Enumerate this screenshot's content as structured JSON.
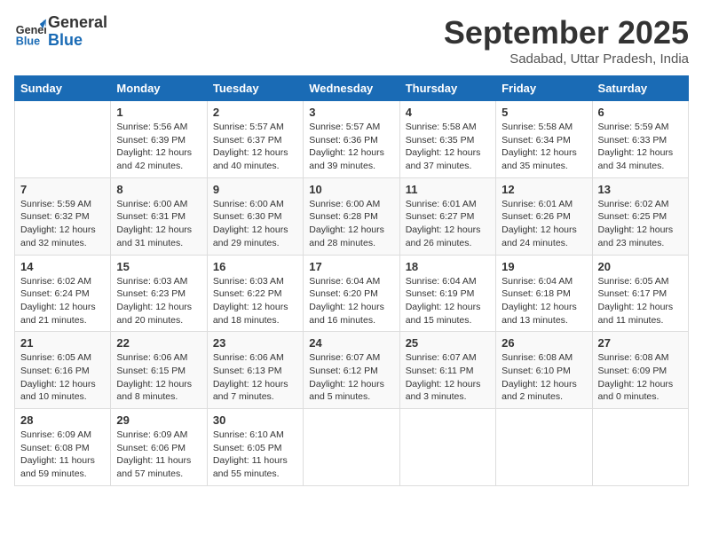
{
  "logo": {
    "line1": "General",
    "line2": "Blue"
  },
  "title": "September 2025",
  "subtitle": "Sadabad, Uttar Pradesh, India",
  "days_of_week": [
    "Sunday",
    "Monday",
    "Tuesday",
    "Wednesday",
    "Thursday",
    "Friday",
    "Saturday"
  ],
  "weeks": [
    [
      {
        "day": "",
        "info": ""
      },
      {
        "day": "1",
        "info": "Sunrise: 5:56 AM\nSunset: 6:39 PM\nDaylight: 12 hours\nand 42 minutes."
      },
      {
        "day": "2",
        "info": "Sunrise: 5:57 AM\nSunset: 6:37 PM\nDaylight: 12 hours\nand 40 minutes."
      },
      {
        "day": "3",
        "info": "Sunrise: 5:57 AM\nSunset: 6:36 PM\nDaylight: 12 hours\nand 39 minutes."
      },
      {
        "day": "4",
        "info": "Sunrise: 5:58 AM\nSunset: 6:35 PM\nDaylight: 12 hours\nand 37 minutes."
      },
      {
        "day": "5",
        "info": "Sunrise: 5:58 AM\nSunset: 6:34 PM\nDaylight: 12 hours\nand 35 minutes."
      },
      {
        "day": "6",
        "info": "Sunrise: 5:59 AM\nSunset: 6:33 PM\nDaylight: 12 hours\nand 34 minutes."
      }
    ],
    [
      {
        "day": "7",
        "info": "Sunrise: 5:59 AM\nSunset: 6:32 PM\nDaylight: 12 hours\nand 32 minutes."
      },
      {
        "day": "8",
        "info": "Sunrise: 6:00 AM\nSunset: 6:31 PM\nDaylight: 12 hours\nand 31 minutes."
      },
      {
        "day": "9",
        "info": "Sunrise: 6:00 AM\nSunset: 6:30 PM\nDaylight: 12 hours\nand 29 minutes."
      },
      {
        "day": "10",
        "info": "Sunrise: 6:00 AM\nSunset: 6:28 PM\nDaylight: 12 hours\nand 28 minutes."
      },
      {
        "day": "11",
        "info": "Sunrise: 6:01 AM\nSunset: 6:27 PM\nDaylight: 12 hours\nand 26 minutes."
      },
      {
        "day": "12",
        "info": "Sunrise: 6:01 AM\nSunset: 6:26 PM\nDaylight: 12 hours\nand 24 minutes."
      },
      {
        "day": "13",
        "info": "Sunrise: 6:02 AM\nSunset: 6:25 PM\nDaylight: 12 hours\nand 23 minutes."
      }
    ],
    [
      {
        "day": "14",
        "info": "Sunrise: 6:02 AM\nSunset: 6:24 PM\nDaylight: 12 hours\nand 21 minutes."
      },
      {
        "day": "15",
        "info": "Sunrise: 6:03 AM\nSunset: 6:23 PM\nDaylight: 12 hours\nand 20 minutes."
      },
      {
        "day": "16",
        "info": "Sunrise: 6:03 AM\nSunset: 6:22 PM\nDaylight: 12 hours\nand 18 minutes."
      },
      {
        "day": "17",
        "info": "Sunrise: 6:04 AM\nSunset: 6:20 PM\nDaylight: 12 hours\nand 16 minutes."
      },
      {
        "day": "18",
        "info": "Sunrise: 6:04 AM\nSunset: 6:19 PM\nDaylight: 12 hours\nand 15 minutes."
      },
      {
        "day": "19",
        "info": "Sunrise: 6:04 AM\nSunset: 6:18 PM\nDaylight: 12 hours\nand 13 minutes."
      },
      {
        "day": "20",
        "info": "Sunrise: 6:05 AM\nSunset: 6:17 PM\nDaylight: 12 hours\nand 11 minutes."
      }
    ],
    [
      {
        "day": "21",
        "info": "Sunrise: 6:05 AM\nSunset: 6:16 PM\nDaylight: 12 hours\nand 10 minutes."
      },
      {
        "day": "22",
        "info": "Sunrise: 6:06 AM\nSunset: 6:15 PM\nDaylight: 12 hours\nand 8 minutes."
      },
      {
        "day": "23",
        "info": "Sunrise: 6:06 AM\nSunset: 6:13 PM\nDaylight: 12 hours\nand 7 minutes."
      },
      {
        "day": "24",
        "info": "Sunrise: 6:07 AM\nSunset: 6:12 PM\nDaylight: 12 hours\nand 5 minutes."
      },
      {
        "day": "25",
        "info": "Sunrise: 6:07 AM\nSunset: 6:11 PM\nDaylight: 12 hours\nand 3 minutes."
      },
      {
        "day": "26",
        "info": "Sunrise: 6:08 AM\nSunset: 6:10 PM\nDaylight: 12 hours\nand 2 minutes."
      },
      {
        "day": "27",
        "info": "Sunrise: 6:08 AM\nSunset: 6:09 PM\nDaylight: 12 hours\nand 0 minutes."
      }
    ],
    [
      {
        "day": "28",
        "info": "Sunrise: 6:09 AM\nSunset: 6:08 PM\nDaylight: 11 hours\nand 59 minutes."
      },
      {
        "day": "29",
        "info": "Sunrise: 6:09 AM\nSunset: 6:06 PM\nDaylight: 11 hours\nand 57 minutes."
      },
      {
        "day": "30",
        "info": "Sunrise: 6:10 AM\nSunset: 6:05 PM\nDaylight: 11 hours\nand 55 minutes."
      },
      {
        "day": "",
        "info": ""
      },
      {
        "day": "",
        "info": ""
      },
      {
        "day": "",
        "info": ""
      },
      {
        "day": "",
        "info": ""
      }
    ]
  ]
}
